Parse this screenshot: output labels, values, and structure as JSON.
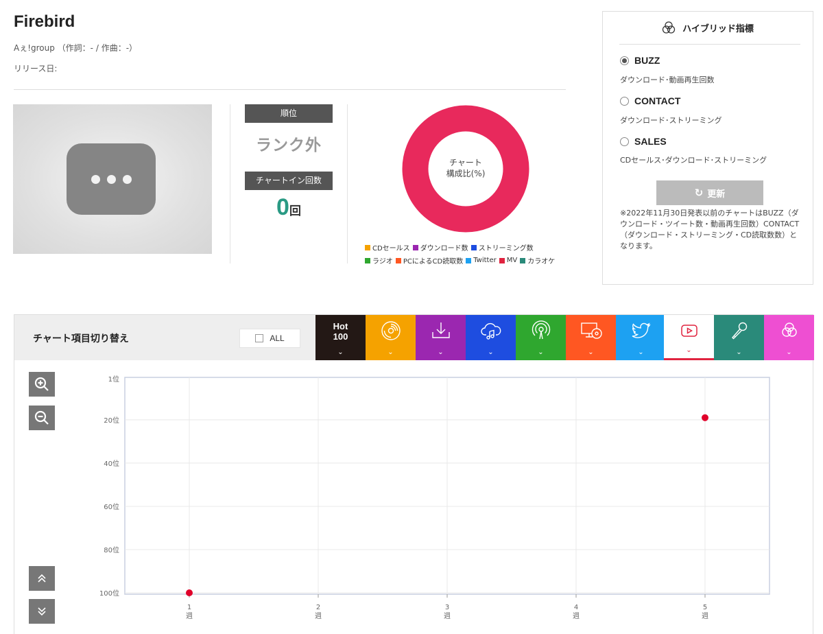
{
  "song": {
    "title": "Firebird",
    "artist_line": "Aぇ!group （作詞：- / 作曲：-）",
    "release_label": "リリース日:"
  },
  "thumbnail": {
    "icon": "more-horizontal-icon"
  },
  "rank": {
    "label": "順位",
    "value": "ランク外",
    "chartin_label": "チャートイン回数",
    "chartin_count": "0",
    "chartin_unit": "回"
  },
  "composition": {
    "label_line1": "チャート",
    "label_line2": "構成比(%)",
    "ring_color": "#e8295c",
    "legend": [
      {
        "label": "CDセールス",
        "color": "#f5a200"
      },
      {
        "label": "ダウンロード数",
        "color": "#9b27b0"
      },
      {
        "label": "ストリーミング数",
        "color": "#1e4de0"
      },
      {
        "label": "ラジオ",
        "color": "#2fa72f"
      },
      {
        "label": "PCによるCD読取数",
        "color": "#ff5722"
      },
      {
        "label": "Twitter",
        "color": "#1da1f2"
      },
      {
        "label": "MV",
        "color": "#e0233f"
      },
      {
        "label": "カラオケ",
        "color": "#2a8a7a"
      }
    ]
  },
  "hybrid": {
    "title": "ハイブリッド指標",
    "options": [
      {
        "name": "BUZZ",
        "desc": "ダウンロード･動画再生回数",
        "selected": true
      },
      {
        "name": "CONTACT",
        "desc": "ダウンロード･ストリーミング",
        "selected": false
      },
      {
        "name": "SALES",
        "desc": "CDセールス･ダウンロード･ストリーミング",
        "selected": false
      }
    ],
    "update_label": "更新",
    "note": "※2022年11月30日発表以前のチャートはBUZZ（ダウンロード・ツイート数・動画再生回数）CONTACT（ダウンロード・ストリーミング・CD読取数数）となります。"
  },
  "chart_switch": {
    "title": "チャート項目切り替え",
    "all_label": "ALL",
    "tabs": [
      {
        "id": "hot100",
        "line1": "Hot",
        "line2": "100",
        "color": "#231815",
        "icon": "hot100-text"
      },
      {
        "id": "cd",
        "color": "#f5a200",
        "icon": "cd-icon"
      },
      {
        "id": "download",
        "color": "#9b27b0",
        "icon": "download-icon"
      },
      {
        "id": "streaming",
        "color": "#1e4de0",
        "icon": "streaming-icon"
      },
      {
        "id": "radio",
        "color": "#2fa72f",
        "icon": "radio-icon"
      },
      {
        "id": "pc-cd",
        "color": "#ff5722",
        "icon": "pc-cd-icon"
      },
      {
        "id": "twitter",
        "color": "#1da1f2",
        "icon": "twitter-icon"
      },
      {
        "id": "mv",
        "color": "#ffffff",
        "icon": "youtube-icon",
        "active": true
      },
      {
        "id": "karaoke",
        "color": "#2a8a7a",
        "icon": "microphone-icon"
      },
      {
        "id": "hybrid",
        "color": "#ee4fd2",
        "icon": "hybrid-icon"
      }
    ]
  },
  "controls": {
    "zoom_in": "zoom-in-icon",
    "zoom_out": "zoom-out-icon",
    "scroll_up": "chevron-double-up-icon",
    "scroll_down": "chevron-double-down-icon"
  },
  "chart_data": {
    "type": "scatter",
    "x_ticks": [
      {
        "value": 1,
        "line1": "1",
        "line2": "週"
      },
      {
        "value": 2,
        "line1": "2",
        "line2": "週"
      },
      {
        "value": 3,
        "line1": "3",
        "line2": "週"
      },
      {
        "value": 4,
        "line1": "4",
        "line2": "週"
      },
      {
        "value": 5,
        "line1": "5",
        "line2": "週"
      }
    ],
    "y_ticks": [
      {
        "value": 1,
        "label": "1位"
      },
      {
        "value": 20,
        "label": "20位"
      },
      {
        "value": 40,
        "label": "40位"
      },
      {
        "value": 60,
        "label": "60位"
      },
      {
        "value": 80,
        "label": "80位"
      },
      {
        "value": 100,
        "label": "100位"
      }
    ],
    "xlim": [
      0.5,
      5.5
    ],
    "ylim": [
      1,
      100
    ],
    "y_inverted": true,
    "grid": true,
    "point_color": "#e0002a",
    "points": [
      {
        "x": 1,
        "y": 100
      },
      {
        "x": 5,
        "y": 19
      }
    ]
  }
}
